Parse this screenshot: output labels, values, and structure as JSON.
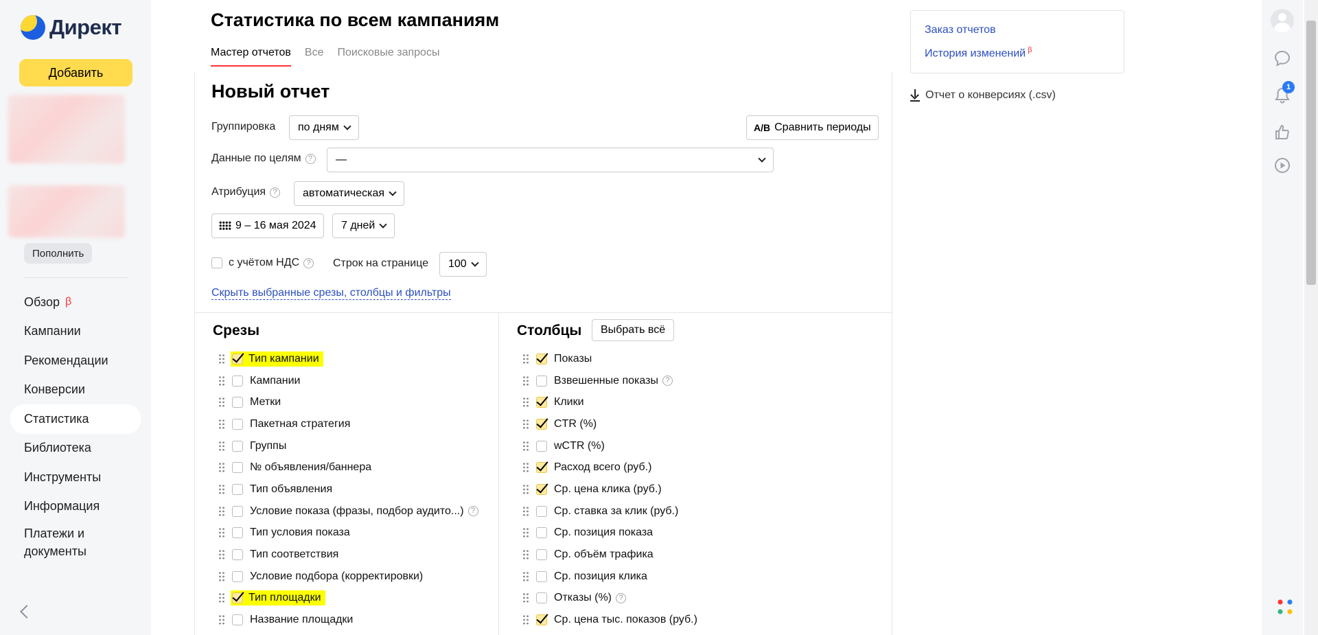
{
  "app": {
    "logo_text": "Директ"
  },
  "sidebar": {
    "add_label": "Добавить",
    "topup_label": "Пополнить",
    "nav": [
      {
        "label": "Обзор",
        "beta": "β"
      },
      {
        "label": "Кампании"
      },
      {
        "label": "Рекомендации"
      },
      {
        "label": "Конверсии"
      },
      {
        "label": "Статистика",
        "active": true
      },
      {
        "label": "Библиотека"
      },
      {
        "label": "Инструменты"
      },
      {
        "label": "Информация"
      },
      {
        "label": "Платежи и документы"
      }
    ]
  },
  "header": {
    "title": "Статистика по всем кампаниям",
    "tabs": [
      "Мастер отчетов",
      "Все",
      "Поисковые запросы"
    ],
    "active_tab": "Мастер отчетов"
  },
  "report": {
    "title": "Новый отчет",
    "grouping_label": "Группировка",
    "grouping_value": "по дням",
    "compare_label": "Сравнить периоды",
    "compare_icon_text": "A/B",
    "goals_label": "Данные по целям",
    "goals_value": "—",
    "attribution_label": "Атрибуция",
    "attribution_value": "автоматическая",
    "date_range": "9 – 16 мая 2024",
    "period_value": "7 дней",
    "vat_label": "с учётом НДС",
    "vat_checked": false,
    "rows_label": "Строк на странице",
    "rows_value": "100",
    "hide_link": "Скрыть выбранные срезы, столбцы и фильтры",
    "help_glyph": "?"
  },
  "slices": {
    "title": "Срезы",
    "items": [
      {
        "label": "Тип кампании",
        "checked": true,
        "highlight": true
      },
      {
        "label": "Кампании",
        "checked": false
      },
      {
        "label": "Метки",
        "checked": false
      },
      {
        "label": "Пакетная стратегия",
        "checked": false
      },
      {
        "label": "Группы",
        "checked": false
      },
      {
        "label": "№ объявления/баннера",
        "checked": false
      },
      {
        "label": "Тип объявления",
        "checked": false
      },
      {
        "label": "Условие показа (фразы, подбор аудито...)",
        "checked": false,
        "help": true
      },
      {
        "label": "Тип условия показа",
        "checked": false
      },
      {
        "label": "Тип соответствия",
        "checked": false
      },
      {
        "label": "Условие подбора (корректировки)",
        "checked": false
      },
      {
        "label": "Тип площадки",
        "checked": true,
        "highlight": true
      },
      {
        "label": "Название площадки",
        "checked": false
      }
    ]
  },
  "columns": {
    "title": "Столбцы",
    "select_all_label": "Выбрать всё",
    "items": [
      {
        "label": "Показы",
        "checked": true
      },
      {
        "label": "Взвешенные показы",
        "checked": false,
        "help": true
      },
      {
        "label": "Клики",
        "checked": true
      },
      {
        "label": "CTR (%)",
        "checked": true
      },
      {
        "label": "wCTR (%)",
        "checked": false
      },
      {
        "label": "Расход всего (руб.)",
        "checked": true
      },
      {
        "label": "Ср. цена клика (руб.)",
        "checked": true
      },
      {
        "label": "Ср. ставка за клик (руб.)",
        "checked": false
      },
      {
        "label": "Ср. позиция показа",
        "checked": false
      },
      {
        "label": "Ср. объём трафика",
        "checked": false
      },
      {
        "label": "Ср. позиция клика",
        "checked": false
      },
      {
        "label": "Отказы (%)",
        "checked": false,
        "help": true
      },
      {
        "label": "Ср. цена тыс. показов (руб.)",
        "checked": true
      }
    ]
  },
  "right_panel": {
    "order_reports": "Заказ отчетов",
    "history": "История изменений",
    "history_beta": "β",
    "conversions_report": "Отчет о конверсиях (.csv)"
  },
  "rail": {
    "notifications_count": "1",
    "icons": [
      "avatar",
      "chat-icon",
      "bell-icon",
      "thumbs-up-icon",
      "play-icon",
      "apps-icon"
    ]
  },
  "colors": {
    "accent_yellow": "#ffdb4d",
    "highlight": "#fbff00",
    "link_blue": "#2b4fc0",
    "active_tab_underline": "#ff3333",
    "beta_red": "#ff3333",
    "badge_blue": "#2a7bf6"
  }
}
